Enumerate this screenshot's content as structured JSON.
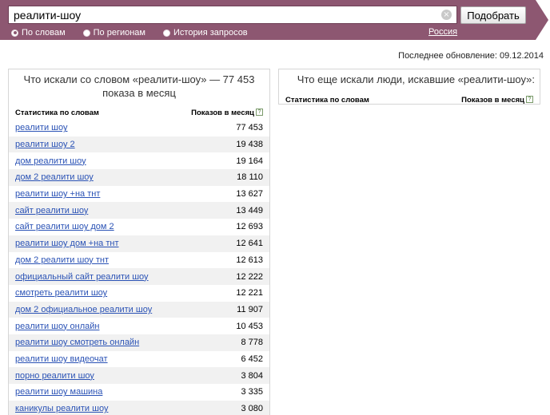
{
  "header": {
    "search_value": "реалити-шоу",
    "search_button": "Подобрать",
    "modes": [
      {
        "label": "По словам",
        "selected": true
      },
      {
        "label": "По регионам",
        "selected": false
      },
      {
        "label": "История запросов",
        "selected": false
      }
    ],
    "region": "Россия",
    "bar_color": "#8d5771"
  },
  "last_update": "Последнее обновление: 09.12.2014",
  "left_panel": {
    "title": "Что искали со словом «реалити-шоу» — 77 453 показа в месяц",
    "col_words": "Статистика по словам",
    "col_count": "Показов в месяц",
    "help": "?",
    "rows": [
      {
        "phrase": "реалити шоу",
        "count": "77 453"
      },
      {
        "phrase": "реалити шоу 2",
        "count": "19 438"
      },
      {
        "phrase": "дом реалити шоу",
        "count": "19 164"
      },
      {
        "phrase": "дом 2 реалити шоу",
        "count": "18 110"
      },
      {
        "phrase": "реалити шоу +на тнт",
        "count": "13 627"
      },
      {
        "phrase": "сайт реалити шоу",
        "count": "13 449"
      },
      {
        "phrase": "сайт реалити шоу дом 2",
        "count": "12 693"
      },
      {
        "phrase": "реалити шоу дом +на тнт",
        "count": "12 641"
      },
      {
        "phrase": "дом 2 реалити шоу тнт",
        "count": "12 613"
      },
      {
        "phrase": "официальный сайт реалити шоу",
        "count": "12 222"
      },
      {
        "phrase": "смотреть реалити шоу",
        "count": "12 221"
      },
      {
        "phrase": "дом 2 официальное реалити шоу",
        "count": "11 907"
      },
      {
        "phrase": "реалити шоу онлайн",
        "count": "10 453"
      },
      {
        "phrase": "реалити шоу смотреть онлайн",
        "count": "8 778"
      },
      {
        "phrase": "реалити шоу видеочат",
        "count": "6 452"
      },
      {
        "phrase": "порно реалити шоу",
        "count": "3 804"
      },
      {
        "phrase": "реалити шоу машина",
        "count": "3 335"
      },
      {
        "phrase": "каникулы реалити шоу",
        "count": "3 080"
      }
    ]
  },
  "right_panel": {
    "title": "Что еще искали люди, искавшие «реалити-шоу»:",
    "col_words": "Статистика по словам",
    "col_count": "Показов в месяц",
    "help": "?"
  }
}
